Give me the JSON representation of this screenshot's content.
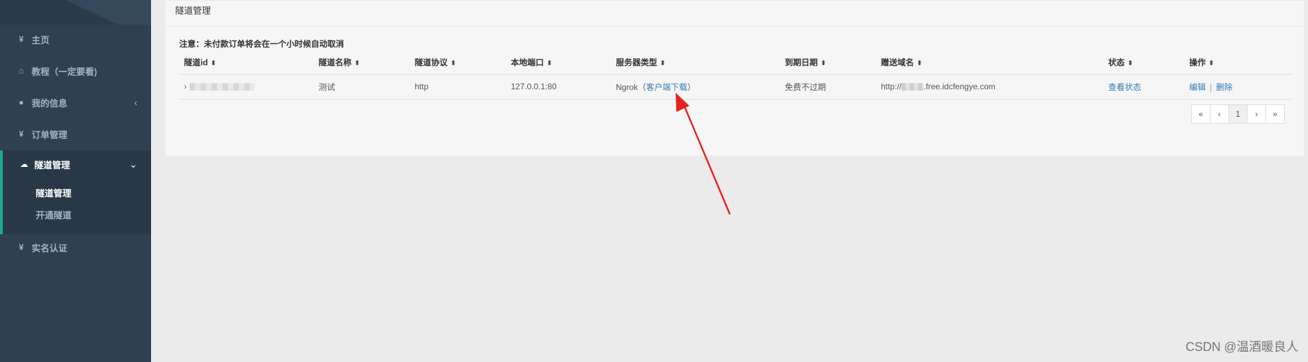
{
  "sidebar": {
    "items": [
      {
        "icon": "¥",
        "label": "主页"
      },
      {
        "icon": "⌂",
        "label": "教程（一定要看)"
      },
      {
        "icon": "●",
        "label": "我的信息"
      },
      {
        "icon": "¥",
        "label": "订单管理"
      },
      {
        "icon": "☁",
        "label": "隧道管理"
      },
      {
        "icon": "¥",
        "label": "实名认证"
      }
    ],
    "subitems": [
      "隧道管理",
      "开通隧道"
    ],
    "chevron_left": "‹",
    "chevron_down": "⌄"
  },
  "panel": {
    "title": "隧道管理",
    "notice": "注意：未付款订单将会在一个小时候自动取消"
  },
  "table": {
    "headers": [
      "隧道id",
      "隧道名称",
      "隧道协议",
      "本地端口",
      "服务器类型",
      "到期日期",
      "赠送域名",
      "状态",
      "操作"
    ],
    "sort_glyph": "⬍",
    "row": {
      "expander": "›",
      "name": "测试",
      "protocol": "http",
      "port": "127.0.0.1:80",
      "server_prefix": "Ngrok（",
      "server_link": "客户端下载",
      "server_suffix": "）",
      "expire": "免费不过期",
      "domain_prefix": "http://",
      "domain_suffix": ".free.idcfengye.com",
      "status_link": "查看状态",
      "edit": "编辑",
      "sep": "|",
      "delete": "删除"
    }
  },
  "pagination": [
    "«",
    "‹",
    "1",
    "›",
    "»"
  ],
  "watermark": "CSDN @温酒暖良人",
  "colors": {
    "sidebar": "#2f4050",
    "accent": "#19aa8d",
    "link": "#337ab7",
    "arrow": "#e8231f"
  }
}
